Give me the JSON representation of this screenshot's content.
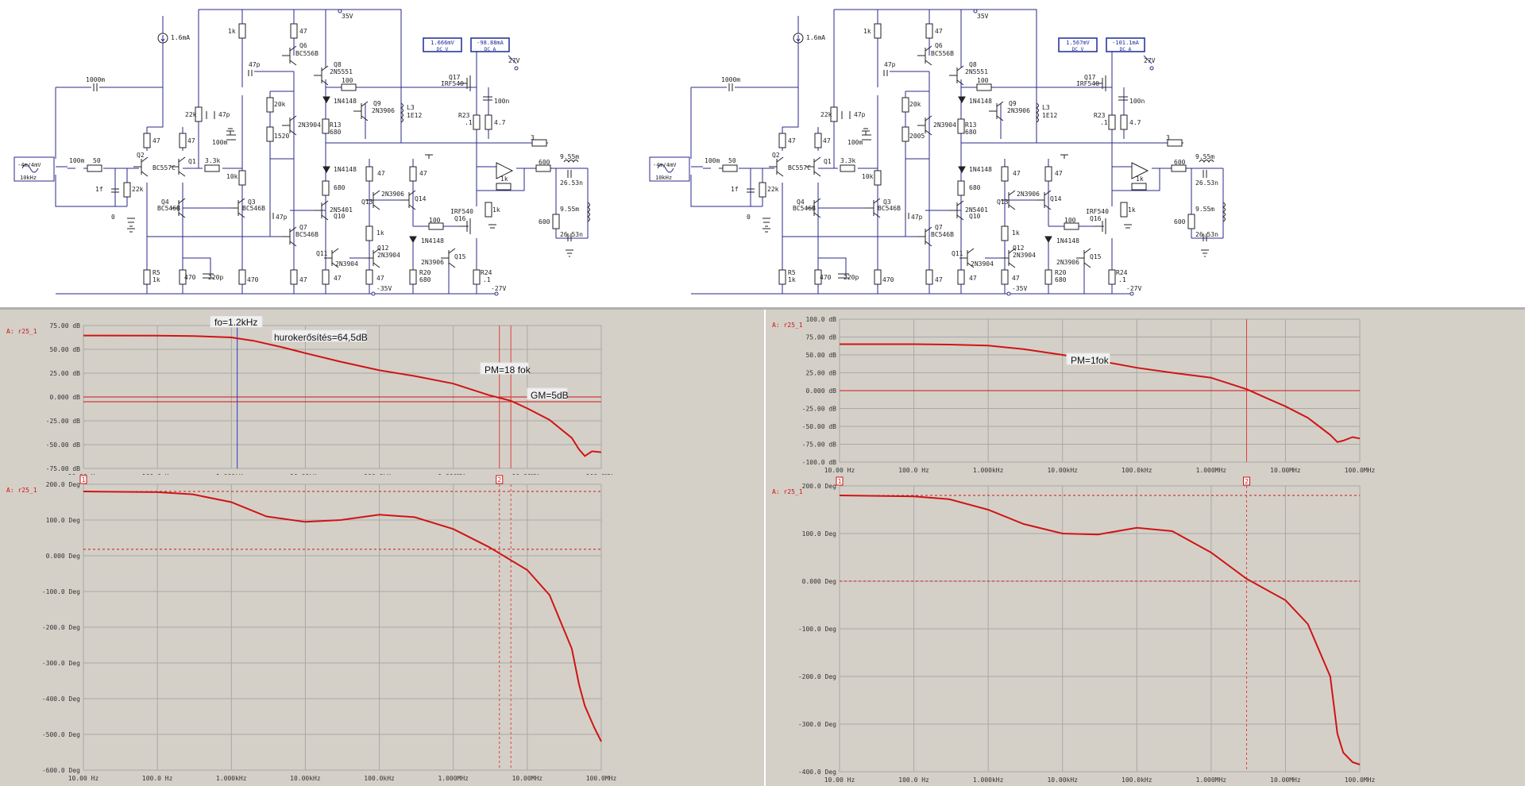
{
  "colors": {
    "wire": "#2a2a8c",
    "component": "#222222",
    "plot_bg": "#d4d0c8",
    "curve": "#d01414",
    "cursor": "#e04040",
    "marker": "#2a3acc",
    "meter_border": "#1a2a9a"
  },
  "schematics": [
    {
      "supply": "35V",
      "current_source": "1.6mA",
      "input_source": {
        "amp": "-4m/4mV",
        "freq": "10kHz"
      },
      "meters": {
        "voltage": {
          "value": "1.666mV",
          "mode": "DC  V"
        },
        "current": {
          "value": "-98.88mA",
          "mode": "DC  A"
        }
      },
      "labels": {
        "c_in": "1000m",
        "c1": "100m",
        "r50": "50",
        "c_1f": "1f",
        "r22k_in": "22k",
        "gnd0": "0",
        "q2": "Q2",
        "q2_type": "BC557C",
        "q1": "Q1",
        "r47_a": "47",
        "r47_b": "47",
        "r22k": "22k",
        "c47p_a": "47p",
        "r1k": "1k",
        "r47_q6": "47",
        "q6": "Q6",
        "q6_type": "BC556B",
        "c47p_b": "47p",
        "q8": "Q8",
        "q8_type": "2N5551",
        "r3k3": "3.3k",
        "c100m": "100m",
        "r10k": "10k",
        "r20k": "20k",
        "r_var": "1520",
        "q_2n3904": "2N3904",
        "r100": "100",
        "d1": "1N4148",
        "r13": "R13",
        "r13_val": "680",
        "q9": "Q9",
        "q9_type": "2N3906",
        "l3": "L3",
        "l3_val": "1E12",
        "q17": "Q17",
        "q17_type": "IRF540",
        "v27": "27V",
        "r23": "R23",
        "r23_val": ".1",
        "c100n": "100n",
        "r4_7": "4.7",
        "r3": "3",
        "q4": "Q4",
        "q4_type": "BC546B",
        "q3": "Q3",
        "q3_type": "BC546B",
        "c47p_c": "47p",
        "d2": "1N4148",
        "r680": "680",
        "q10_type": "2N5401",
        "q10": "Q10",
        "q7": "Q7",
        "q7_type": "BC546B",
        "r47_c": "47",
        "r47_d": "47",
        "q13": "Q13",
        "q13_type": "2N3906",
        "q14": "Q14",
        "r1k_b": "1k",
        "r100_b": "100",
        "irf": "IRF540",
        "q16": "Q16",
        "d3": "1N4148",
        "q11": "Q11",
        "q11_type": "2N3904",
        "q12": "Q12",
        "q12_type": "2N3904",
        "r47_e": "47",
        "r47_f": "47",
        "v_neg35": "-35V",
        "r20": "R20",
        "r20_val": "680",
        "q15_type": "2N3906",
        "q15": "Q15",
        "r24": "R24",
        "r24_val": ".1",
        "v_neg27": "-27V",
        "r5": "R5",
        "r5_val": "1k",
        "r470_a": "470",
        "c220p": "220p",
        "r470_b": "470",
        "r47_g": "47",
        "r600_a": "600",
        "l_a": "9.55m",
        "c_a": "26.53n",
        "r1k_fb": "1k",
        "r1k_c": "1k",
        "r600": "600",
        "l_b": "9.55m",
        "c_b": "26.53n"
      }
    },
    {
      "supply": "35V",
      "current_source": "1.6mA",
      "input_source": {
        "amp": "-4m/4mV",
        "freq": "10kHz"
      },
      "meters": {
        "voltage": {
          "value": "1.567mV",
          "mode": "DC  V"
        },
        "current": {
          "value": "-101.1mA",
          "mode": "DC  A"
        }
      },
      "labels": {
        "c_in": "1000m",
        "c1": "100m",
        "r50": "50",
        "c_1f": "1f",
        "r22k_in": "22k",
        "gnd0": "0",
        "q2": "Q2",
        "q2_type": "BC557C",
        "q1": "Q1",
        "r47_a": "47",
        "r47_b": "47",
        "r22k": "22k",
        "c47p_a": "47p",
        "r1k": "1k",
        "r47_q6": "47",
        "q6": "Q6",
        "q6_type": "BC556B",
        "c47p_b": "47p",
        "q8": "Q8",
        "q8_type": "2N5551",
        "r3k3": "3.3k",
        "c100m": "100m",
        "r10k": "10k",
        "r20k": "20k",
        "r_var": "2005",
        "q_2n3904": "2N3904",
        "r100": "100",
        "d1": "1N4148",
        "r13": "R13",
        "r13_val": "680",
        "q9": "Q9",
        "q9_type": "2N3906",
        "l3": "L3",
        "l3_val": "1E12",
        "q17": "Q17",
        "q17_type": "IRF540",
        "v27": "27V",
        "r23": "R23",
        "r23_val": ".1",
        "c100n": "100n",
        "r4_7": "4.7",
        "r3": "3",
        "q4": "Q4",
        "q4_type": "BC546B",
        "q3": "Q3",
        "q3_type": "BC546B",
        "c47p_c": "47p",
        "d2": "1N4148",
        "r680": "680",
        "q10_type": "2N5401",
        "q10": "Q10",
        "q7": "Q7",
        "q7_type": "BC546B",
        "r47_c": "47",
        "r47_d": "47",
        "q13": "Q13",
        "q13_type": "2N3906",
        "q14": "Q14",
        "r1k_b": "1k",
        "r100_b": "100",
        "irf": "IRF540",
        "q16": "Q16",
        "d3": "1N4148",
        "q11": "Q11",
        "q11_type": "2N3904",
        "q12": "Q12",
        "q12_type": "2N3904",
        "r47_e": "47",
        "r47_f": "47",
        "v_neg35": "-35V",
        "r20": "R20",
        "r20_val": "680",
        "q15_type": "2N3906",
        "q15": "Q15",
        "r24": "R24",
        "r24_val": ".1",
        "v_neg27": "-27V",
        "r5": "R5",
        "r5_val": "1k",
        "r470_a": "470",
        "c220p": "220p",
        "r470_b": "470",
        "r47_g": "47",
        "r600_a": "600",
        "l_a": "9.55m",
        "c_a": "26.53n",
        "r1k_fb": "1k",
        "r1k_c": "1k",
        "r600": "600",
        "l_b": "9.55m",
        "c_b": "26.53n"
      }
    }
  ],
  "chart_data": [
    {
      "type": "line",
      "trace": "A: r25_1",
      "xscale": "log",
      "x_ticks": [
        "10.00 Hz",
        "100.0 Hz",
        "1.000kHz",
        "10.00kHz",
        "100.0kHz",
        "1.000MHz",
        "10.00MHz",
        "100.0MHz"
      ],
      "ylim": [
        -75,
        75
      ],
      "y_ticks": [
        "75.00 dB",
        "50.00 dB",
        "25.00 dB",
        "0.000 dB",
        "-25.00 dB",
        "-50.00 dB",
        "-75.00 dB"
      ],
      "series": [
        {
          "x": [
            10,
            100,
            300,
            1000,
            2000,
            5000,
            10000,
            30000,
            100000,
            300000,
            1000000,
            3000000,
            6000000,
            10000000,
            20000000,
            40000000,
            50000000,
            60000000,
            75000000,
            100000000
          ],
          "y": [
            64.5,
            64.4,
            64,
            62.5,
            59,
            52,
            46,
            37,
            28,
            22,
            14,
            2,
            -4,
            -12,
            -24,
            -43,
            -55,
            -62,
            -57,
            -58
          ]
        }
      ],
      "annotations": [
        "fo=1.2kHz",
        "hurokerősítés=64,5dB",
        "PM=18 fok",
        "GM=5dB"
      ],
      "marker_x": 1200,
      "cursor_x": [
        4200000,
        6000000
      ],
      "hlines": [
        0,
        -5
      ]
    },
    {
      "type": "line",
      "trace": "A: r25_1",
      "xscale": "log",
      "x_ticks": [
        "10.00 Hz",
        "100.0 Hz",
        "1.000kHz",
        "10.00kHz",
        "100.0kHz",
        "1.000MHz",
        "10.00MHz",
        "100.0MHz"
      ],
      "ylim": [
        -600,
        200
      ],
      "y_ticks": [
        "200.0 Deg",
        "100.0 Deg",
        "0.000 Deg",
        "-100.0 Deg",
        "-200.0 Deg",
        "-300.0 Deg",
        "-400.0 Deg",
        "-500.0 Deg",
        "-600.0 Deg"
      ],
      "series": [
        {
          "x": [
            10,
            100,
            300,
            1000,
            3000,
            10000,
            30000,
            100000,
            300000,
            1000000,
            3000000,
            10000000,
            20000000,
            40000000,
            50000000,
            60000000,
            80000000,
            100000000
          ],
          "y": [
            180,
            178,
            172,
            150,
            110,
            95,
            100,
            115,
            108,
            75,
            25,
            -40,
            -110,
            -260,
            -360,
            -420,
            -480,
            -520
          ]
        }
      ],
      "cursor_x": [
        4200000,
        6000000
      ],
      "cursor_ids": [
        "1",
        "2"
      ],
      "hlines_dashed": [
        180,
        18
      ]
    },
    {
      "type": "line",
      "trace": "A: r25_1",
      "xscale": "log",
      "x_ticks": [
        "10.00 Hz",
        "100.0 Hz",
        "1.000kHz",
        "10.00kHz",
        "100.0kHz",
        "1.000MHz",
        "10.00MHz",
        "100.0MHz"
      ],
      "ylim": [
        -100,
        100
      ],
      "y_ticks": [
        "100.0 dB",
        "75.00 dB",
        "50.00 dB",
        "25.00 dB",
        "0.000 dB",
        "-25.00 dB",
        "-50.00 dB",
        "-75.00 dB",
        "-100.0 dB"
      ],
      "series": [
        {
          "x": [
            10,
            100,
            300,
            1000,
            3000,
            10000,
            30000,
            100000,
            300000,
            1000000,
            3000000,
            6000000,
            10000000,
            20000000,
            40000000,
            50000000,
            60000000,
            80000000,
            100000000
          ],
          "y": [
            65,
            65,
            64.5,
            63,
            58,
            50,
            42,
            32,
            25,
            18,
            2,
            -12,
            -22,
            -38,
            -62,
            -72,
            -70,
            -65,
            -67
          ]
        }
      ],
      "annotations": [
        "PM=1fok"
      ],
      "cursor_x": [
        3000000
      ],
      "hlines": [
        0
      ]
    },
    {
      "type": "line",
      "trace": "A: r25_1",
      "xscale": "log",
      "x_ticks": [
        "10.00 Hz",
        "100.0 Hz",
        "1.000kHz",
        "10.00kHz",
        "100.0kHz",
        "1.000MHz",
        "10.00MHz",
        "100.0MHz"
      ],
      "ylim": [
        -400,
        200
      ],
      "y_ticks": [
        "200.0 Deg",
        "100.0 Deg",
        "0.000 Deg",
        "-100.0 Deg",
        "-200.0 Deg",
        "-300.0 Deg",
        "-400.0 Deg"
      ],
      "series": [
        {
          "x": [
            10,
            100,
            300,
            1000,
            3000,
            10000,
            30000,
            100000,
            300000,
            1000000,
            3000000,
            10000000,
            20000000,
            40000000,
            50000000,
            60000000,
            80000000,
            100000000
          ],
          "y": [
            180,
            178,
            172,
            150,
            120,
            100,
            98,
            112,
            105,
            60,
            5,
            -40,
            -90,
            -200,
            -320,
            -360,
            -380,
            -385
          ]
        }
      ],
      "cursor_x": [
        3000000
      ],
      "cursor_ids": [
        "1",
        "2"
      ],
      "hlines_dashed": [
        180,
        0
      ]
    }
  ]
}
